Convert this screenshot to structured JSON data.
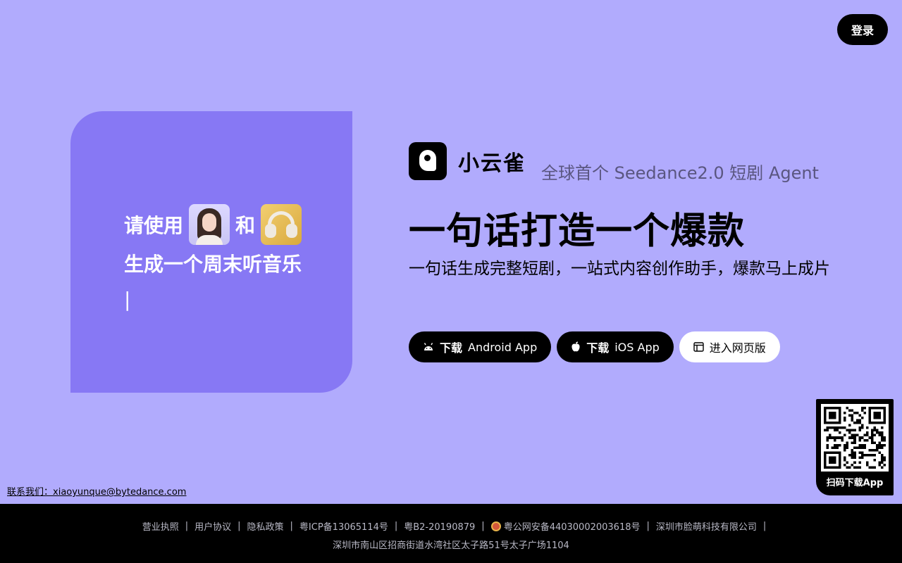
{
  "header": {
    "login_label": "登录"
  },
  "demo": {
    "prefix": "请使用",
    "connector": "和",
    "line2": "生成一个周末听音乐",
    "cursor": "|"
  },
  "brand": {
    "name": "小云雀",
    "tagline": "全球首个 Seedance2.0 短剧 Agent"
  },
  "hero": {
    "headline": "一句话打造一个爆款",
    "subline": "一句话生成完整短剧，一站式内容创作助手，爆款马上成片"
  },
  "cta": {
    "android_bold": "下载",
    "android_label": "Android App",
    "ios_bold": "下载",
    "ios_label": "iOS App",
    "web_label": "进入网页版"
  },
  "qr": {
    "label": "扫码下载App"
  },
  "contact": {
    "label": "联系我们：",
    "email": "xiaoyunque@bytedance.com"
  },
  "footer": {
    "links": [
      "营业执照",
      "用户协议",
      "隐私政策",
      "粤ICP备13065114号",
      "粤B2-20190879",
      "粤公网安备44030002003618号",
      "深圳市脸萌科技有限公司"
    ],
    "address": "深圳市南山区招商街道水湾社区太子路51号太子广场1104"
  },
  "colors": {
    "background": "#b1abfd",
    "card": "#8778f4",
    "dark": "#000000",
    "footer_text": "#b9b9c6"
  },
  "icons": {
    "android": "android-icon",
    "apple": "apple-icon",
    "web": "browser-window-icon",
    "logo": "xiaoyunque-logo-icon",
    "police": "police-badge-icon"
  }
}
